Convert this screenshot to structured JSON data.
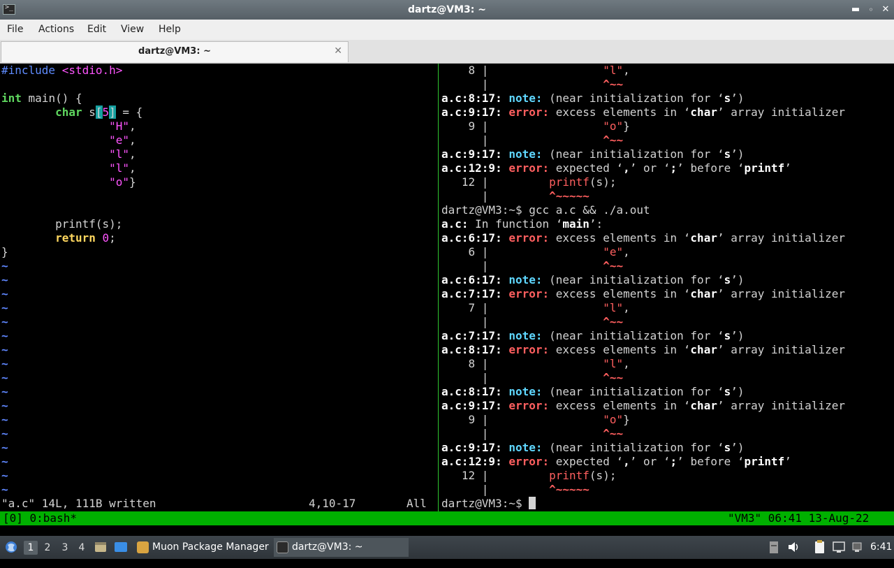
{
  "window": {
    "title": "dartz@VM3: ~"
  },
  "menu": {
    "items": [
      "File",
      "Actions",
      "Edit",
      "View",
      "Help"
    ]
  },
  "tab": {
    "label": "dartz@VM3: ~"
  },
  "vim": {
    "tilde": "~",
    "status_file": "\"a.c\" 14L, 111B written",
    "status_pos": "4,10-17",
    "status_scroll": "All"
  },
  "tmux": {
    "left": "[0] 0:bash*",
    "right": "\"VM3\" 06:41 13-Aug-22"
  },
  "taskbar": {
    "workspaces": [
      "1",
      "2",
      "3",
      "4"
    ],
    "task_muon": "Muon Package Manager",
    "task_terminal": "dartz@VM3: ~",
    "clock": "6:41"
  },
  "colors": {
    "tmux_bar": "#00b000",
    "pane_divider": "#2ec52e",
    "error": "#ff5f5f",
    "note": "#5fd7ff",
    "string": "#ff55ff",
    "type": "#5fd75f",
    "keyword": "#ffd75f",
    "vim_tilde": "#5f87ff",
    "bracket_highlight": "#16a0a0"
  },
  "code_lines": [
    [
      [
        "#include ",
        "pre"
      ],
      [
        "<stdio.h>",
        "str"
      ]
    ],
    [],
    [
      [
        "int",
        "type"
      ],
      [
        " main() {",
        ""
      ]
    ],
    [
      [
        "        ",
        ""
      ],
      [
        "char",
        "type"
      ],
      [
        " s",
        ""
      ],
      [
        "[",
        "hl"
      ],
      [
        "5",
        "num"
      ],
      [
        "]",
        "hl"
      ],
      [
        " = {",
        ""
      ]
    ],
    [
      [
        "                ",
        ""
      ],
      [
        "\"H\"",
        "str"
      ],
      [
        ",",
        ""
      ]
    ],
    [
      [
        "                ",
        ""
      ],
      [
        "\"e\"",
        "str"
      ],
      [
        ",",
        ""
      ]
    ],
    [
      [
        "                ",
        ""
      ],
      [
        "\"l\"",
        "str"
      ],
      [
        ",",
        ""
      ]
    ],
    [
      [
        "                ",
        ""
      ],
      [
        "\"l\"",
        "str"
      ],
      [
        ",",
        ""
      ]
    ],
    [
      [
        "                ",
        ""
      ],
      [
        "\"o\"",
        "str"
      ],
      [
        "}",
        ""
      ]
    ],
    [],
    [],
    [
      [
        "        printf(s);",
        ""
      ]
    ],
    [
      [
        "        ",
        ""
      ],
      [
        "return",
        "kw"
      ],
      [
        " ",
        ""
      ],
      [
        "0",
        "num"
      ],
      [
        ";",
        ""
      ]
    ],
    [
      [
        "}",
        ""
      ]
    ]
  ],
  "term_lines": [
    [
      [
        "    8 |                 ",
        ""
      ],
      [
        "\"l\"",
        "red"
      ],
      [
        ",",
        ""
      ]
    ],
    [
      [
        "      |                 ",
        ""
      ],
      [
        "^~~",
        "caret"
      ]
    ],
    [
      [
        "a.c:8:17: ",
        "b"
      ],
      [
        "note:",
        "note"
      ],
      [
        " (near initialization for ‘",
        ""
      ],
      [
        "s",
        "b"
      ],
      [
        "’)",
        ""
      ]
    ],
    [
      [
        "a.c:9:17: ",
        "b"
      ],
      [
        "error:",
        "err"
      ],
      [
        " excess elements in ‘",
        ""
      ],
      [
        "char",
        "b"
      ],
      [
        "’ array initializer",
        ""
      ]
    ],
    [
      [
        "    9 |                 ",
        ""
      ],
      [
        "\"o\"",
        "red"
      ],
      [
        "}",
        ""
      ]
    ],
    [
      [
        "      |                 ",
        ""
      ],
      [
        "^~~",
        "caret"
      ]
    ],
    [
      [
        "a.c:9:17: ",
        "b"
      ],
      [
        "note:",
        "note"
      ],
      [
        " (near initialization for ‘",
        ""
      ],
      [
        "s",
        "b"
      ],
      [
        "’)",
        ""
      ]
    ],
    [
      [
        "a.c:12:9: ",
        "b"
      ],
      [
        "error:",
        "err"
      ],
      [
        " expected ‘",
        ""
      ],
      [
        ",",
        "b"
      ],
      [
        "’ or ‘",
        ""
      ],
      [
        ";",
        "b"
      ],
      [
        "’ before ‘",
        ""
      ],
      [
        "printf",
        "b"
      ],
      [
        "’",
        ""
      ]
    ],
    [
      [
        "   12 |         ",
        ""
      ],
      [
        "printf",
        "red"
      ],
      [
        "(s);",
        ""
      ]
    ],
    [
      [
        "      |         ",
        ""
      ],
      [
        "^~~~~~",
        "caret"
      ]
    ],
    [
      [
        "dartz@VM3:~$ gcc a.c && ./a.out",
        ""
      ]
    ],
    [
      [
        "a.c:",
        "b"
      ],
      [
        " In function ‘",
        ""
      ],
      [
        "main",
        "b"
      ],
      [
        "’:",
        ""
      ]
    ],
    [
      [
        "a.c:6:17: ",
        "b"
      ],
      [
        "error:",
        "err"
      ],
      [
        " excess elements in ‘",
        ""
      ],
      [
        "char",
        "b"
      ],
      [
        "’ array initializer",
        ""
      ]
    ],
    [
      [
        "    6 |                 ",
        ""
      ],
      [
        "\"e\"",
        "red"
      ],
      [
        ",",
        ""
      ]
    ],
    [
      [
        "      |                 ",
        ""
      ],
      [
        "^~~",
        "caret"
      ]
    ],
    [
      [
        "a.c:6:17: ",
        "b"
      ],
      [
        "note:",
        "note"
      ],
      [
        " (near initialization for ‘",
        ""
      ],
      [
        "s",
        "b"
      ],
      [
        "’)",
        ""
      ]
    ],
    [
      [
        "a.c:7:17: ",
        "b"
      ],
      [
        "error:",
        "err"
      ],
      [
        " excess elements in ‘",
        ""
      ],
      [
        "char",
        "b"
      ],
      [
        "’ array initializer",
        ""
      ]
    ],
    [
      [
        "    7 |                 ",
        ""
      ],
      [
        "\"l\"",
        "red"
      ],
      [
        ",",
        ""
      ]
    ],
    [
      [
        "      |                 ",
        ""
      ],
      [
        "^~~",
        "caret"
      ]
    ],
    [
      [
        "a.c:7:17: ",
        "b"
      ],
      [
        "note:",
        "note"
      ],
      [
        " (near initialization for ‘",
        ""
      ],
      [
        "s",
        "b"
      ],
      [
        "’)",
        ""
      ]
    ],
    [
      [
        "a.c:8:17: ",
        "b"
      ],
      [
        "error:",
        "err"
      ],
      [
        " excess elements in ‘",
        ""
      ],
      [
        "char",
        "b"
      ],
      [
        "’ array initializer",
        ""
      ]
    ],
    [
      [
        "    8 |                 ",
        ""
      ],
      [
        "\"l\"",
        "red"
      ],
      [
        ",",
        ""
      ]
    ],
    [
      [
        "      |                 ",
        ""
      ],
      [
        "^~~",
        "caret"
      ]
    ],
    [
      [
        "a.c:8:17: ",
        "b"
      ],
      [
        "note:",
        "note"
      ],
      [
        " (near initialization for ‘",
        ""
      ],
      [
        "s",
        "b"
      ],
      [
        "’)",
        ""
      ]
    ],
    [
      [
        "a.c:9:17: ",
        "b"
      ],
      [
        "error:",
        "err"
      ],
      [
        " excess elements in ‘",
        ""
      ],
      [
        "char",
        "b"
      ],
      [
        "’ array initializer",
        ""
      ]
    ],
    [
      [
        "    9 |                 ",
        ""
      ],
      [
        "\"o\"",
        "red"
      ],
      [
        "}",
        ""
      ]
    ],
    [
      [
        "      |                 ",
        ""
      ],
      [
        "^~~",
        "caret"
      ]
    ],
    [
      [
        "a.c:9:17: ",
        "b"
      ],
      [
        "note:",
        "note"
      ],
      [
        " (near initialization for ‘",
        ""
      ],
      [
        "s",
        "b"
      ],
      [
        "’)",
        ""
      ]
    ],
    [
      [
        "a.c:12:9: ",
        "b"
      ],
      [
        "error:",
        "err"
      ],
      [
        " expected ‘",
        ""
      ],
      [
        ",",
        "b"
      ],
      [
        "’ or ‘",
        ""
      ],
      [
        ";",
        "b"
      ],
      [
        "’ before ‘",
        ""
      ],
      [
        "printf",
        "b"
      ],
      [
        "’",
        ""
      ]
    ],
    [
      [
        "   12 |         ",
        ""
      ],
      [
        "printf",
        "red"
      ],
      [
        "(s);",
        ""
      ]
    ],
    [
      [
        "      |         ",
        ""
      ],
      [
        "^~~~~~",
        "caret"
      ]
    ],
    [
      [
        "dartz@VM3:~$ ",
        ""
      ]
    ]
  ]
}
